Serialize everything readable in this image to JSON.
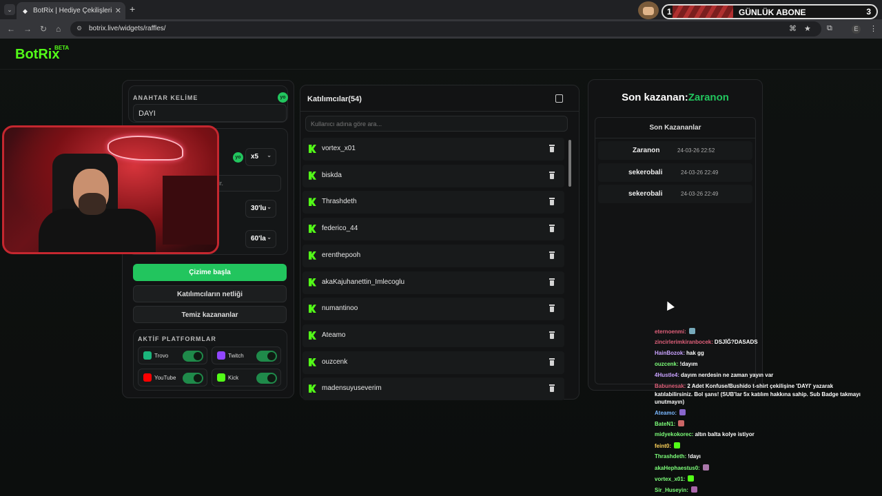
{
  "browser": {
    "tab_title": "BotRix | Hediye Çekilişleri",
    "url": "botrix.live/widgets/raffles/",
    "profile_initial": "E"
  },
  "overlay": {
    "left_num": "1",
    "label": "GÜNLÜK ABONE",
    "right_num": "3"
  },
  "site": {
    "logo": "BotRix",
    "beta": "BETA"
  },
  "settings": {
    "keyword_label": "ANAHTAR KELİME",
    "keyword_value": "DAYI",
    "yo_badge": "yo",
    "multiplier": "x5",
    "hint_fragment": "lir.",
    "select_1": "30'lu",
    "select_2": "60'la",
    "start_button": "Çizime başla",
    "clear_participants_button": "Katılımcıların netliği",
    "clear_winners_button": "Temiz kazananlar",
    "platforms_label": "AKTİF PLATFORMLAR",
    "platforms": [
      {
        "name": "Trovo",
        "icon": "trovo-icon",
        "color": "#1bb57c",
        "on": true
      },
      {
        "name": "Twitch",
        "icon": "twitch-icon",
        "color": "#9146ff",
        "on": true
      },
      {
        "name": "YouTube",
        "icon": "youtube-icon",
        "color": "#ff0000",
        "on": true
      },
      {
        "name": "Kick",
        "icon": "kick-icon",
        "color": "#53fc18",
        "on": true
      }
    ]
  },
  "participants": {
    "title": "Katılımcılar(54)",
    "search_placeholder": "Kullanıcı adına göre ara...",
    "list": [
      "vortex_x01",
      "biskda",
      "Thrashdeth",
      "federico_44",
      "erenthepooh",
      "akaKajuhanettin_Imlecoglu",
      "numantinoo",
      "Ateamo",
      "ouzcenk",
      "madensuyuseverim"
    ]
  },
  "winners": {
    "title_prefix": "Son kazanan:",
    "title_name": "Zaranon",
    "list_title": "Son Kazananlar",
    "list": [
      {
        "name": "Zaranon",
        "date": "24-03-26 22:52"
      },
      {
        "name": "sekerobali",
        "date": "24-03-26 22:49"
      },
      {
        "name": "sekerobali",
        "date": "24-03-26 22:49"
      }
    ]
  },
  "chat": [
    {
      "user": "eternoenmi:",
      "color": "#e0607a",
      "text": "",
      "emote": "#7ab"
    },
    {
      "user": "zincirlerimkiranbocek:",
      "color": "#e0607a",
      "text": "DSJİĞ?DASADS",
      "emote": ""
    },
    {
      "user": "HainBozok:",
      "color": "#c9a2ff",
      "text": "hak gg",
      "emote": ""
    },
    {
      "user": "ouzcenk:",
      "color": "#7dff7a",
      "text": "!dayım",
      "emote": ""
    },
    {
      "user": "4Hustle4:",
      "color": "#c9a2ff",
      "text": "dayım nerdesin ne zaman yayın var",
      "emote": ""
    },
    {
      "user": "Babunesak:",
      "color": "#e0607a",
      "text": "2 Adet Konfuse/Bushido t-shirt çekilişine 'DAYI' yazarak",
      "emote": ""
    },
    {
      "user": "",
      "color": "#fff",
      "text": "katılabilirsiniz. Bol şans! (SUB'lar 5x katılım hakkına sahip. Sub Badge takmayı",
      "emote": ""
    },
    {
      "user": "",
      "color": "#fff",
      "text": "unutmayın)",
      "emote": ""
    },
    {
      "user": "Ateamo:",
      "color": "#7ab8ff",
      "text": "",
      "emote": "#86c"
    },
    {
      "user": "BateN1:",
      "color": "#7dff7a",
      "text": "",
      "emote": "#c66"
    },
    {
      "user": "midyekokorec:",
      "color": "#7dff7a",
      "text": "altın balta kolye istiyor",
      "emote": ""
    },
    {
      "user": "feint0:",
      "color": "#ffd35a",
      "text": "",
      "emote": "#53fc18"
    },
    {
      "user": "Thrashdeth:",
      "color": "#7dff7a",
      "text": "!dayı",
      "emote": ""
    },
    {
      "user": "akaHephaestus0:",
      "color": "#7dff7a",
      "text": "",
      "emote": "#a7a"
    },
    {
      "user": "vortex_x01:",
      "color": "#7dff7a",
      "text": "",
      "emote": "#53fc18"
    },
    {
      "user": "Sir_Huseyin:",
      "color": "#7dff7a",
      "text": "",
      "emote": "#a6a"
    }
  ]
}
